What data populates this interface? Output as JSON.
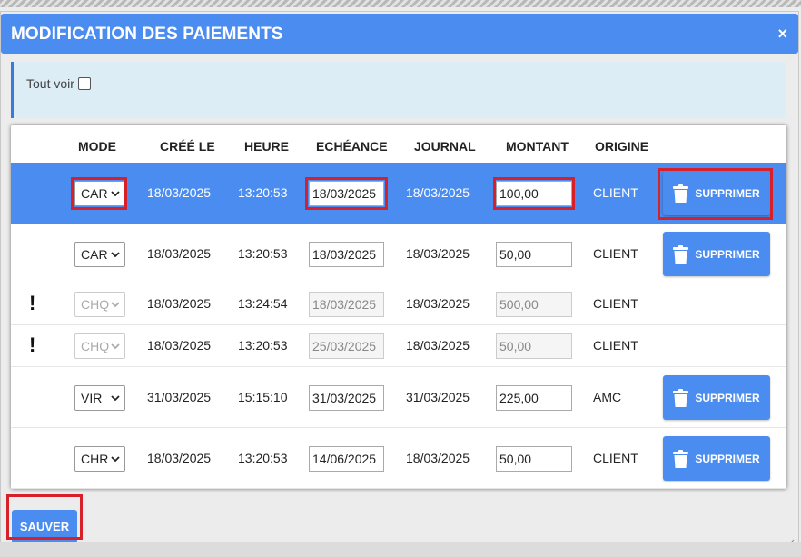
{
  "modal": {
    "title": "MODIFICATION DES PAIEMENTS",
    "close_glyph": "×",
    "show_all_label": "Tout voir",
    "save_label": "SAUVER"
  },
  "table": {
    "headers": [
      "MODE",
      "CRÉÉ LE",
      "HEURE",
      "ECHÉANCE",
      "JOURNAL",
      "MONTANT",
      "ORIGINE"
    ],
    "delete_label": "SUPPRIMER",
    "rows": [
      {
        "mode": "CAR",
        "created": "18/03/2025",
        "time": "13:20:53",
        "due": "18/03/2025",
        "journal": "18/03/2025",
        "amount": "100,00",
        "origin": "CLIENT",
        "deletable": true,
        "locked": false,
        "selected": true
      },
      {
        "mode": "CAR",
        "created": "18/03/2025",
        "time": "13:20:53",
        "due": "18/03/2025",
        "journal": "18/03/2025",
        "amount": "50,00",
        "origin": "CLIENT",
        "deletable": true,
        "locked": false,
        "selected": false
      },
      {
        "mode": "CHQ",
        "created": "18/03/2025",
        "time": "13:24:54",
        "due": "18/03/2025",
        "journal": "18/03/2025",
        "amount": "500,00",
        "origin": "CLIENT",
        "deletable": false,
        "locked": true,
        "selected": false,
        "warning": "!"
      },
      {
        "mode": "CHQ",
        "created": "18/03/2025",
        "time": "13:20:53",
        "due": "25/03/2025",
        "journal": "18/03/2025",
        "amount": "50,00",
        "origin": "CLIENT",
        "deletable": false,
        "locked": true,
        "selected": false,
        "warning": "!"
      },
      {
        "mode": "VIR",
        "created": "31/03/2025",
        "time": "15:15:10",
        "due": "31/03/2025",
        "journal": "31/03/2025",
        "amount": "225,00",
        "origin": "AMC",
        "deletable": true,
        "locked": false,
        "selected": false
      },
      {
        "mode": "CHR",
        "created": "18/03/2025",
        "time": "13:20:53",
        "due": "14/06/2025",
        "journal": "18/03/2025",
        "amount": "50,00",
        "origin": "CLIENT",
        "deletable": true,
        "locked": false,
        "selected": false
      }
    ]
  },
  "colors": {
    "accent": "#4b8cf0",
    "highlight": "#d6202a",
    "info_bg": "#dcedf5"
  },
  "icons": {
    "delete": "trash-icon",
    "close": "close-icon",
    "dropdown": "chevron-down-icon",
    "warning": "exclamation-icon"
  }
}
